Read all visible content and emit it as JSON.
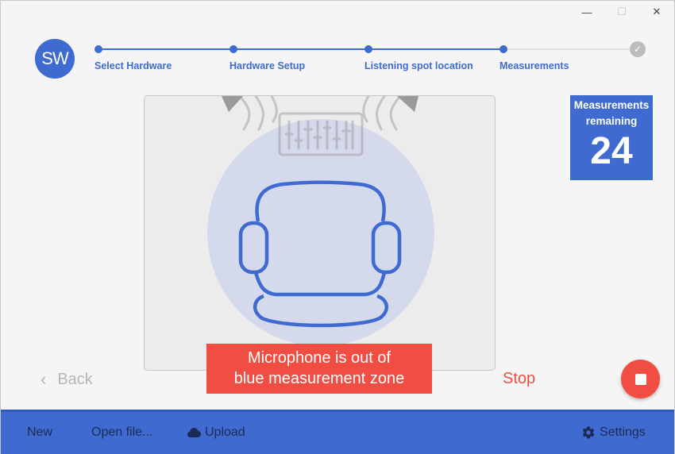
{
  "window": {
    "minimize_glyph": "—",
    "maximize_glyph": "☐",
    "close_glyph": "✕"
  },
  "logo": {
    "text": "SW"
  },
  "stepper": {
    "steps": [
      {
        "label": "Select Hardware",
        "state": "complete"
      },
      {
        "label": "Hardware Setup",
        "state": "complete"
      },
      {
        "label": "Listening spot location",
        "state": "complete"
      },
      {
        "label": "Measurements",
        "state": "current"
      },
      {
        "label": "",
        "state": "final-check"
      }
    ],
    "check_glyph": "✓"
  },
  "measurements": {
    "label": "Measurements remaining",
    "count": "24"
  },
  "alert": {
    "line1": "Microphone is out of",
    "line2": "blue measurement zone"
  },
  "nav": {
    "back_label": "Back",
    "back_glyph": "‹",
    "stop_label": "Stop"
  },
  "bottombar": {
    "new_label": "New",
    "open_label": "Open file...",
    "upload_label": "Upload",
    "settings_label": "Settings",
    "upload_icon": "cloud-icon",
    "settings_icon": "gear-icon"
  },
  "colors": {
    "accent": "#3f6bd0",
    "alert": "#f24d42",
    "zone": "#d4d9ec",
    "bottombar_text": "#1d2a55"
  }
}
